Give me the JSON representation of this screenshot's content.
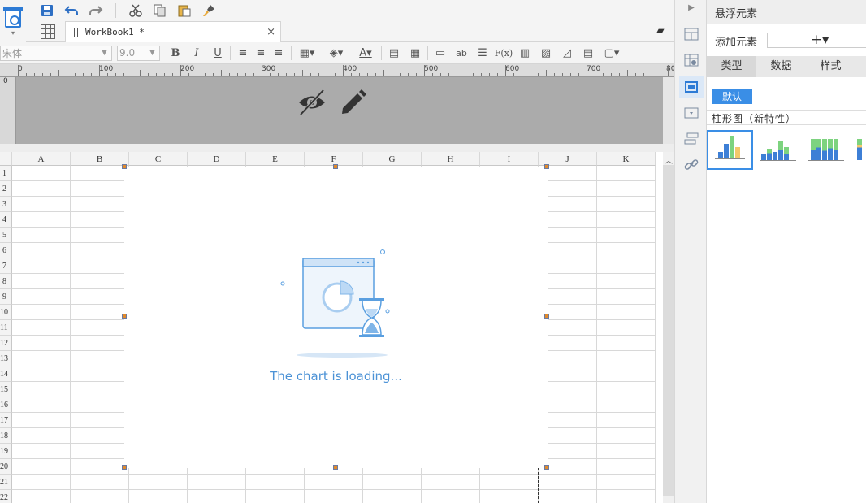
{
  "toolbar": {
    "quick_icons": [
      "save-icon",
      "undo-icon",
      "redo-icon",
      "cut-icon",
      "copy-icon",
      "paste-icon",
      "format-painter-icon"
    ],
    "font_name": "宋体",
    "font_size": "9.0",
    "bold_label": "B",
    "italic_label": "I",
    "underline_label": "U",
    "ab_label": "ab",
    "fx_label": "F(x)"
  },
  "tabs": [
    {
      "label": "WorkBook1 *",
      "close": "×"
    }
  ],
  "ruler": {
    "marks": [
      "0",
      "100",
      "200",
      "300",
      "400",
      "500",
      "600",
      "700",
      "80"
    ],
    "vmark": "0"
  },
  "sheet": {
    "columns": [
      "A",
      "B",
      "C",
      "D",
      "E",
      "F",
      "G",
      "H",
      "I",
      "J",
      "K"
    ],
    "rows": [
      "1",
      "2",
      "3",
      "4",
      "5",
      "6",
      "7",
      "8",
      "9",
      "10",
      "11",
      "12",
      "13",
      "14",
      "15",
      "16",
      "17",
      "18",
      "19",
      "20",
      "21",
      "22"
    ]
  },
  "chart": {
    "loading_text": "The chart is loading..."
  },
  "panel": {
    "title": "悬浮元素",
    "add_label": "添加元素",
    "add_button": "+▾",
    "tabs": [
      "类型",
      "数据",
      "样式"
    ],
    "default_button": "默认",
    "chart_type_header": "柱形图（新特性）"
  },
  "colors": {
    "accent": "#3a8ee6",
    "loading": "#4c92d6",
    "bar_blue": "#3d7fd6",
    "bar_green": "#7dd37f",
    "bar_yellow": "#f4c86b"
  }
}
